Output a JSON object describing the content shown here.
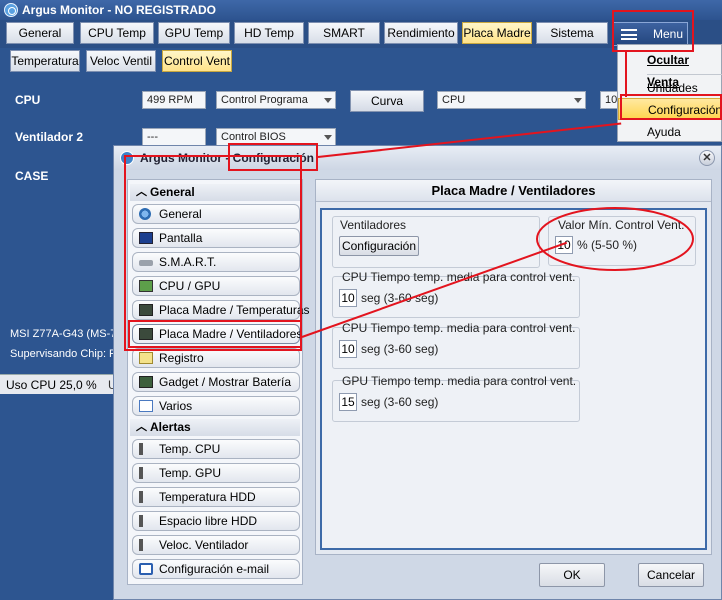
{
  "main_window": {
    "title": "Argus Monitor - NO REGISTRADO",
    "tabs": [
      "General",
      "CPU Temp",
      "GPU Temp",
      "HD Temp",
      "SMART",
      "Rendimiento",
      "Placa Madre",
      "Sistema"
    ],
    "menu_label": "Menu",
    "subtabs": [
      "Temperatura",
      "Veloc Ventil",
      "Control Vent"
    ],
    "rows": [
      {
        "label": "CPU",
        "rpm": "499 RPM",
        "mode": "Control Programa",
        "button": "Curva",
        "source": "CPU",
        "extra": "10"
      },
      {
        "label": "Ventilador 2",
        "rpm": "---",
        "mode": "Control BIOS"
      },
      {
        "label": "CASE"
      }
    ],
    "board_text": "MSI Z77A-G43 (MS-7",
    "chip_text": "Supervisando Chip: F",
    "status_cpu": "Uso CPU 25,0 %",
    "status_sep": "U"
  },
  "menu_dropdown": {
    "items": [
      "Ocultar Venta",
      "Unidades",
      "Configuración",
      "Ayuda"
    ]
  },
  "dialog": {
    "title": "Argus Monitor - Configuración",
    "sections": [
      {
        "name": "General",
        "items": [
          "General",
          "Pantalla",
          "S.M.A.R.T.",
          "CPU / GPU",
          "Placa Madre / Temperaturas",
          "Placa Madre / Ventiladores",
          "Registro",
          "Gadget / Mostrar Batería",
          "Varios"
        ]
      },
      {
        "name": "Alertas",
        "items": [
          "Temp. CPU",
          "Temp. GPU",
          "Temperatura HDD",
          "Espacio libre HDD",
          "Veloc. Ventilador",
          "Configuración e-mail"
        ]
      }
    ],
    "panel_title": "Placa Madre / Ventiladores",
    "fans_group_label": "Ventiladores",
    "fans_button": "Configuración",
    "min_label": "Valor Mín. Control Vent.",
    "min_value": "10",
    "min_range": "% (5-50 %)",
    "groups": [
      {
        "label": "CPU Tiempo temp. media para control vent.",
        "value": "10",
        "unit": "seg (3-60 seg)"
      },
      {
        "label": "CPU Tiempo temp. media para control vent.",
        "value": "10",
        "unit": "seg (3-60 seg)"
      },
      {
        "label": "GPU Tiempo temp. media para control vent.",
        "value": "15",
        "unit": "seg (3-60 seg)"
      }
    ],
    "ok": "OK",
    "cancel": "Cancelar"
  },
  "colors": {
    "highlight_red": "#e3141e",
    "active_tab": "#ffe38a",
    "window_blue": "#2d5590"
  }
}
